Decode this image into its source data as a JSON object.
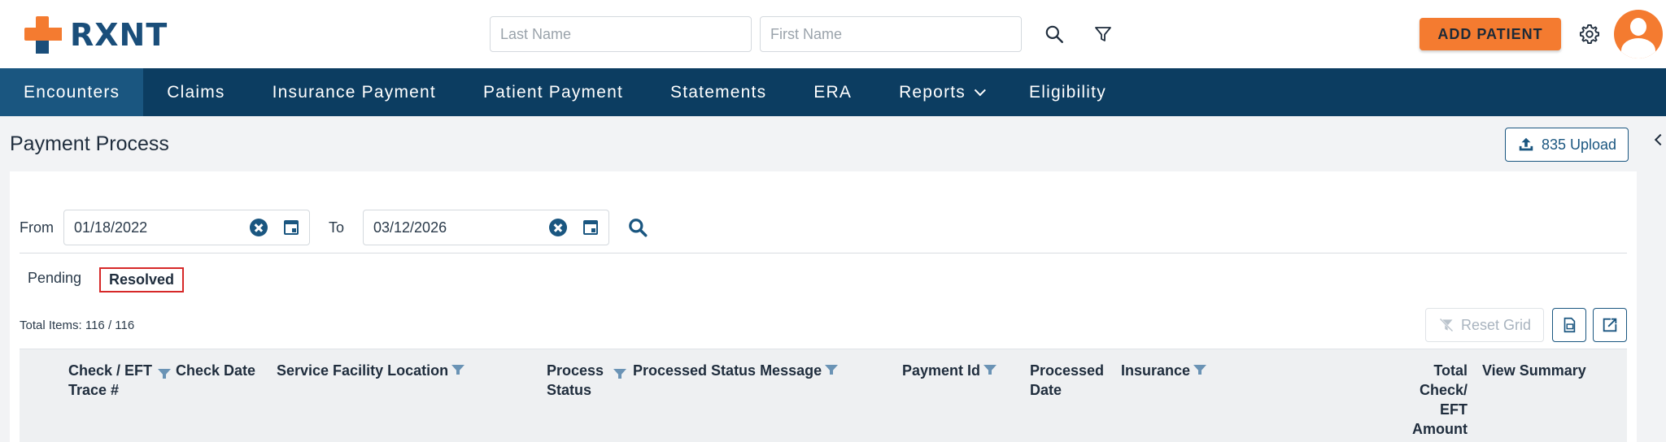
{
  "brand": {
    "name": "RXNT"
  },
  "header": {
    "last_name_placeholder": "Last Name",
    "first_name_placeholder": "First Name",
    "add_patient_label": "ADD PATIENT"
  },
  "nav": {
    "items": [
      {
        "label": "Encounters",
        "active": true
      },
      {
        "label": "Claims"
      },
      {
        "label": "Insurance Payment"
      },
      {
        "label": "Patient Payment"
      },
      {
        "label": "Statements"
      },
      {
        "label": "ERA"
      },
      {
        "label": "Reports",
        "has_dropdown": true
      },
      {
        "label": "Eligibility"
      }
    ]
  },
  "page": {
    "title": "Payment Process",
    "upload_label": "835 Upload"
  },
  "filters": {
    "from_label": "From",
    "from_value": "01/18/2022",
    "to_label": "To",
    "to_value": "03/12/2026"
  },
  "tabs": [
    {
      "label": "Pending",
      "selected": false
    },
    {
      "label": "Resolved",
      "selected": true
    }
  ],
  "grid": {
    "total_items": "Total Items: 116 / 116",
    "reset_label": "Reset Grid",
    "columns": [
      {
        "label": "Check / EFT Trace #",
        "filter": true
      },
      {
        "label": "Check Date",
        "filter": false
      },
      {
        "label": "Service Facility Location",
        "filter": true
      },
      {
        "label": "Process Status",
        "filter": true
      },
      {
        "label": "Processed Status Message",
        "filter": true
      },
      {
        "label": "Payment Id",
        "filter": true
      },
      {
        "label": "Processed Date",
        "filter": false
      },
      {
        "label": "Insurance",
        "filter": true
      },
      {
        "label": "Total Check/ EFT Amount",
        "filter": false
      },
      {
        "label": "View Summary",
        "filter": false
      }
    ]
  },
  "colors": {
    "nav_bg": "#0c3d61",
    "nav_active": "#1a5680",
    "accent_orange": "#f47b30",
    "primary_blue": "#1a5680",
    "selected_tab_border": "#d62828"
  },
  "icons": [
    "search-icon",
    "filter-icon",
    "gear-icon",
    "avatar",
    "upload-icon",
    "clear-icon",
    "calendar-icon",
    "reset-filter-icon",
    "export-icon",
    "collapse-icon"
  ]
}
